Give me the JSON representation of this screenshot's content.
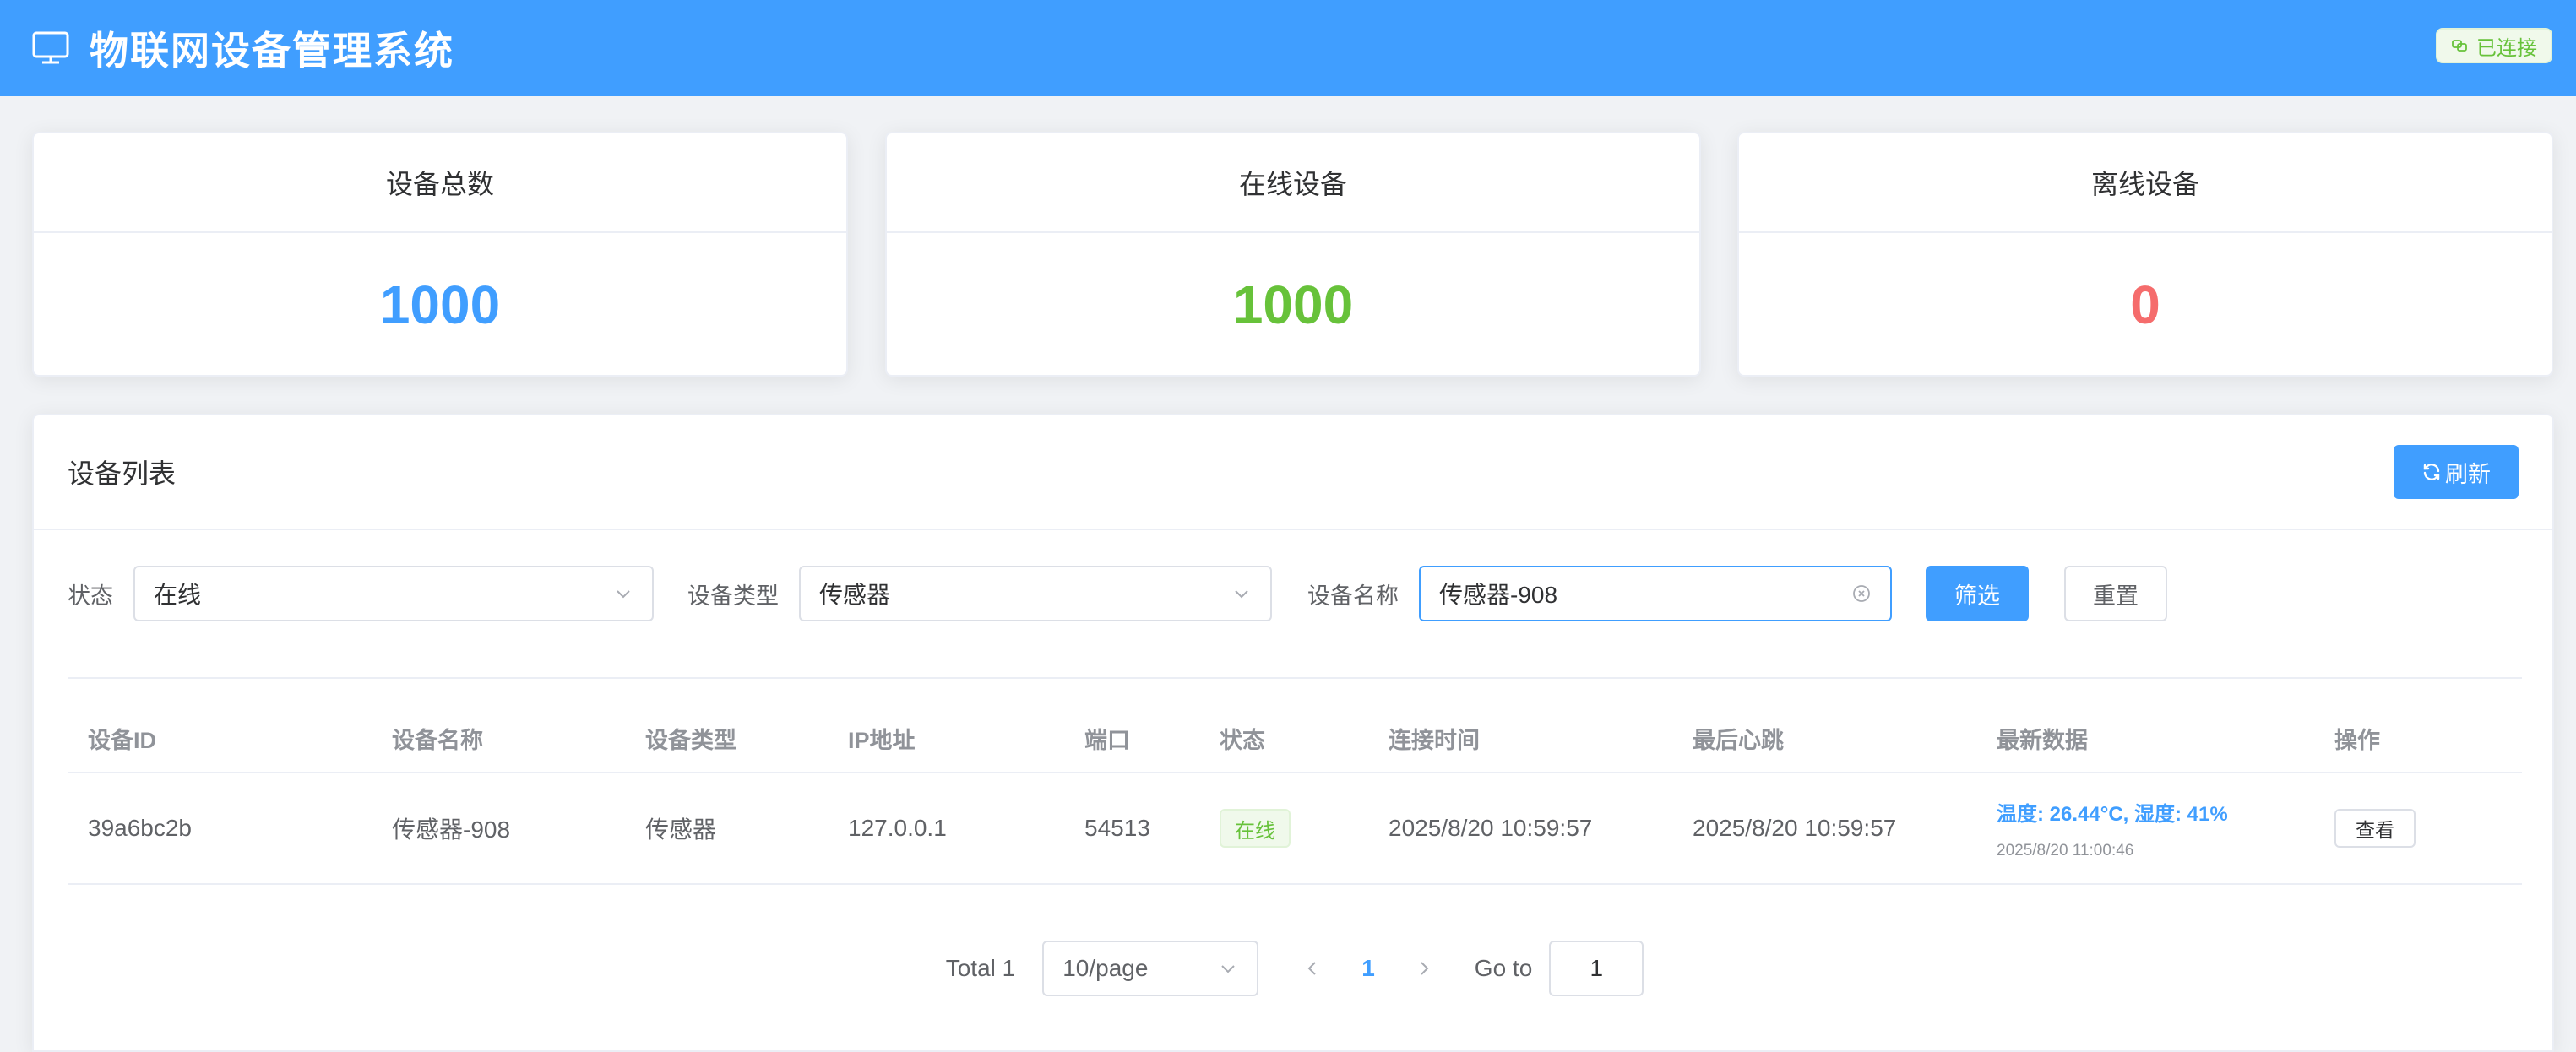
{
  "header": {
    "title": "物联网设备管理系统",
    "connection_status": "已连接"
  },
  "stats": [
    {
      "label": "设备总数",
      "value": "1000"
    },
    {
      "label": "在线设备",
      "value": "1000"
    },
    {
      "label": "离线设备",
      "value": "0"
    }
  ],
  "colors": {
    "header_bg": "#409eff",
    "total": "#409eff",
    "online": "#67c23a",
    "offline": "#f56c6c"
  },
  "device_list": {
    "title": "设备列表",
    "refresh_label": "刷新"
  },
  "filters": {
    "status_label": "状态",
    "status_value": "在线",
    "type_label": "设备类型",
    "type_value": "传感器",
    "name_label": "设备名称",
    "name_value": "传感器-908",
    "filter_button": "筛选",
    "reset_button": "重置"
  },
  "table": {
    "columns": [
      "设备ID",
      "设备名称",
      "设备类型",
      "IP地址",
      "端口",
      "状态",
      "连接时间",
      "最后心跳",
      "最新数据",
      "操作"
    ],
    "rows": [
      {
        "id": "39a6bc2b",
        "name": "传感器-908",
        "type": "传感器",
        "ip": "127.0.0.1",
        "port": "54513",
        "status": "在线",
        "connect_time": "2025/8/20 10:59:57",
        "last_heartbeat": "2025/8/20 10:59:57",
        "latest_data": "温度: 26.44°C, 湿度: 41%",
        "latest_data_time": "2025/8/20 11:00:46",
        "action": "查看"
      }
    ]
  },
  "pagination": {
    "total_label": "Total 1",
    "page_size": "10/page",
    "current_page": "1",
    "goto_label": "Go to",
    "goto_value": "1"
  },
  "icons": {
    "header": "monitor-icon",
    "connection": "link-icon",
    "refresh": "refresh-icon",
    "select": "chevron-down-icon",
    "clear": "clear-icon",
    "prev": "chevron-left-icon",
    "next": "chevron-right-icon"
  }
}
